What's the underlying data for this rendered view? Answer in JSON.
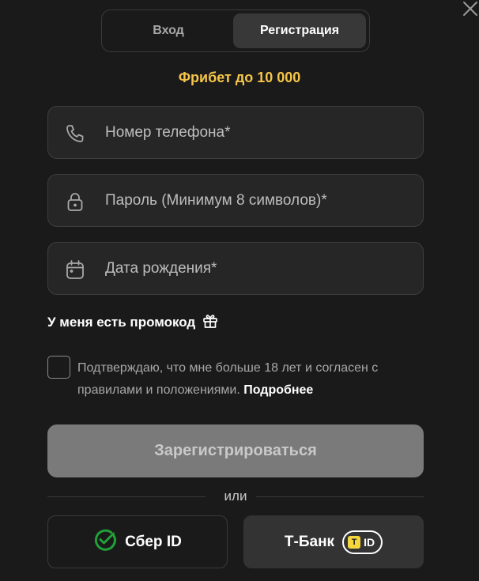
{
  "tabs": {
    "login": "Вход",
    "register": "Регистрация",
    "active": "register"
  },
  "bonus": "Фрибет до 10 000",
  "fields": {
    "phone": {
      "placeholder": "Номер телефона*",
      "icon": "phone-icon"
    },
    "password": {
      "placeholder": "Пароль (Минимум 8 символов)*",
      "icon": "lock-icon"
    },
    "birthdate": {
      "placeholder": "Дата рождения*",
      "icon": "calendar-icon"
    }
  },
  "promo": {
    "label": "У меня есть промокод",
    "icon": "gift-icon"
  },
  "agreement": {
    "text": "Подтверждаю, что мне больше 18 лет и согласен с правилами и положениями.",
    "link": "Подробнее",
    "checked": false
  },
  "submit_label": "Зарегистрироваться",
  "divider_text": "или",
  "social": {
    "sber": {
      "label": "Сбер ID",
      "icon": "sber-logo-icon"
    },
    "tbank": {
      "label": "Т-Банк",
      "badge": "ID",
      "badge_letter": "T",
      "icon": "tbank-id-icon"
    }
  },
  "colors": {
    "background": "#1a1a1a",
    "accent": "#f5c54a",
    "field_bg": "#262626",
    "submit_bg": "#7a7a7a",
    "sber_green": "#21a038",
    "tbank_yellow": "#f5d63d"
  }
}
